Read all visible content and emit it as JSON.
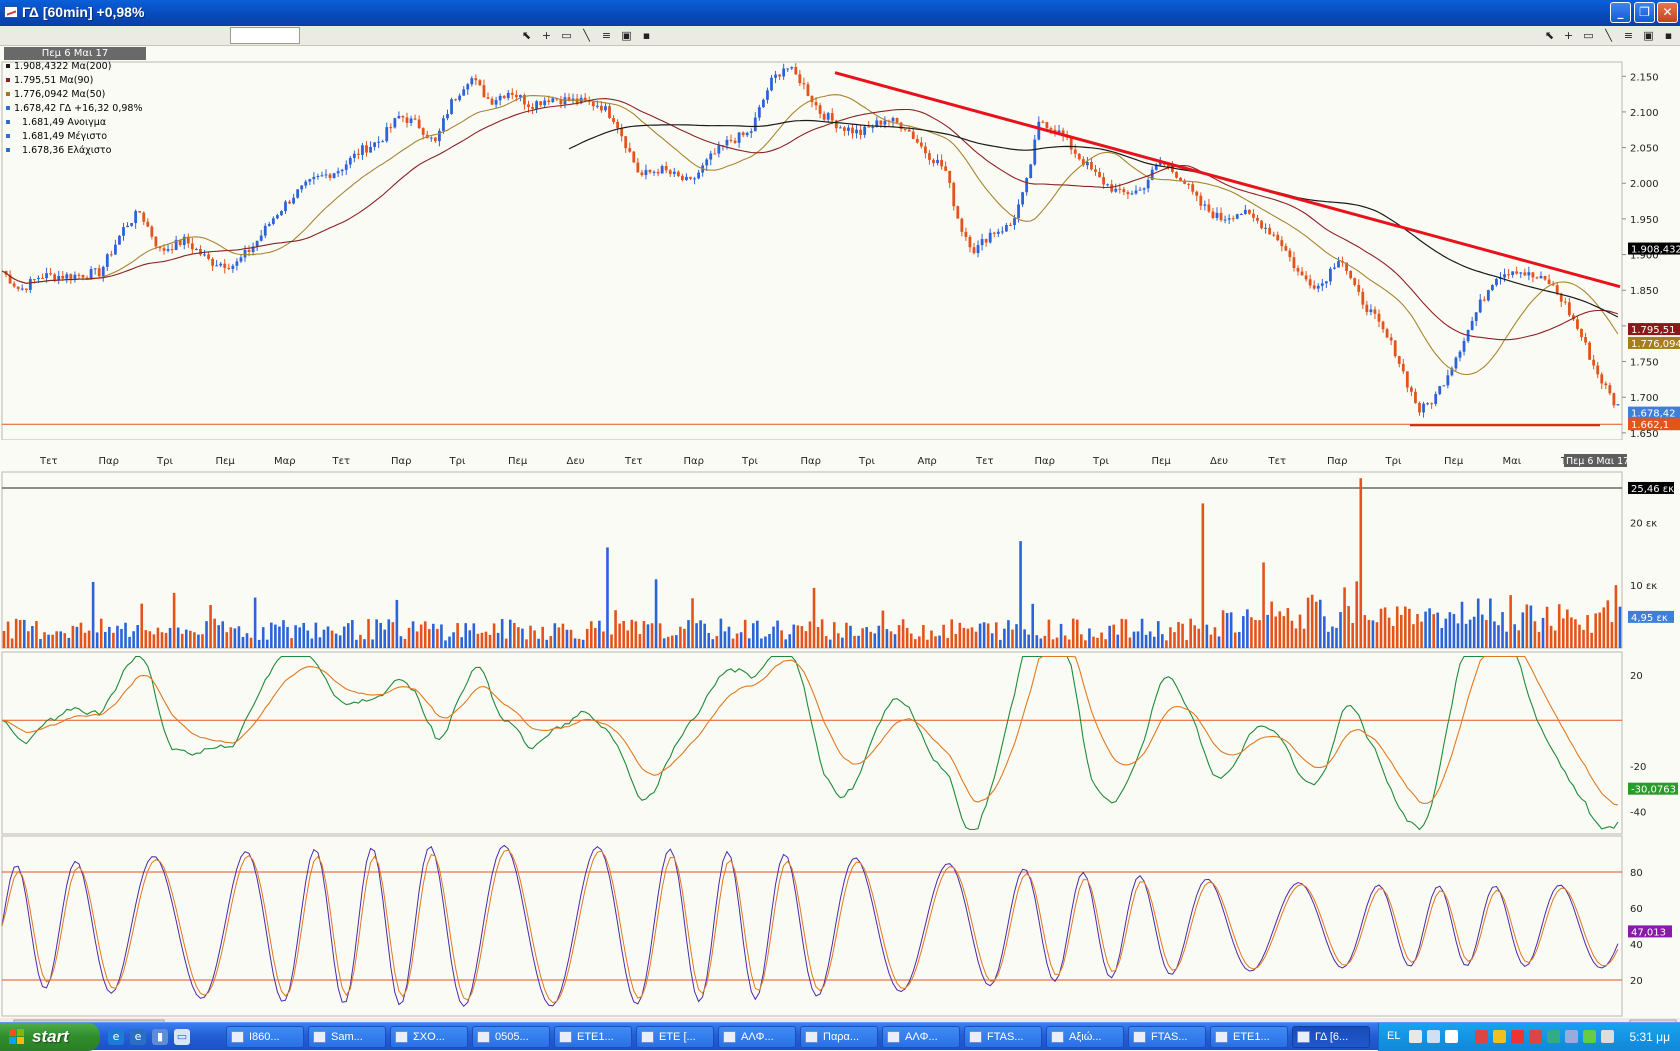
{
  "window": {
    "title": "ΓΔ [60min] +0,98%",
    "min": "_",
    "restore": "❐",
    "close": "✕"
  },
  "legend": {
    "date": "Πεμ 6 Μαι 17",
    "rows": [
      {
        "text": "1.908,4322 Μα(200)",
        "color": "#1a1a1a"
      },
      {
        "text": "1.795,51 Μα(90)",
        "color": "#8a2020"
      },
      {
        "text": "1.776,0942 Μα(50)",
        "color": "#9a7a2a"
      },
      {
        "text": "1.678,42 ΓΔ +16,32 0,98%",
        "color": "#2d6fc9"
      },
      {
        "text": "1.681,49 Ανοιγμα",
        "color": "#2d6fc9"
      },
      {
        "text": "1.681,49 Μέγιστο",
        "color": "#2d6fc9"
      },
      {
        "text": "1.678,36 Ελάχιστο",
        "color": "#2d6fc9"
      }
    ]
  },
  "price_axis": [
    "2.150",
    "2.100",
    "2.050",
    "2.000",
    "1.950",
    "1.900",
    "1.850",
    "1.800",
    "1.750",
    "1.700",
    "1.650"
  ],
  "price_tags": [
    {
      "text": "1.908,432",
      "value": 1908.43,
      "color": "#000000"
    },
    {
      "text": "1.795,51",
      "value": 1795.51,
      "color": "#8a1a1a"
    },
    {
      "text": "1.776,094",
      "value": 1776.09,
      "color": "#a67c1c"
    },
    {
      "text": "1.678,42",
      "value": 1678.42,
      "color": "#3d7fd9"
    },
    {
      "text": "1.662,1",
      "value": 1662.1,
      "color": "#e2541c"
    }
  ],
  "time_axis": [
    "Τετ",
    "Παρ",
    "Τρι",
    "Πεμ",
    "Μαρ",
    "Τετ",
    "Παρ",
    "Τρι",
    "Πεμ",
    "Δευ",
    "Τετ",
    "Παρ",
    "Τρι",
    "Παρ",
    "Τρι",
    "Απρ",
    "Τετ",
    "Παρ",
    "Τρι",
    "Πεμ",
    "Δευ",
    "Τετ",
    "Παρ",
    "Τρι",
    "Πεμ",
    "Μαι",
    "Τ"
  ],
  "time_cursor": "Πεμ 6 Μαι 17",
  "volume_axis": [
    "20 εκ",
    "10 εκ"
  ],
  "volume_tags": [
    {
      "text": "25,46 εκ",
      "color": "#000000"
    },
    {
      "text": "4,95 εκ",
      "color": "#3d7fd9"
    }
  ],
  "macd_axis": [
    "20",
    "-20",
    "-40"
  ],
  "macd_tags": [
    {
      "text": "-30,0763",
      "color": "#2a9a2a"
    }
  ],
  "stoch_axis": [
    "80",
    "60",
    "40",
    "20"
  ],
  "stoch_tags": [
    {
      "text": "47,013",
      "color": "#8a1aa8"
    }
  ],
  "colors": {
    "up": "#2d63d8",
    "down": "#e2541c",
    "trend": "#e8121a",
    "ma200": "#1a1a1a",
    "ma90": "#8a2222",
    "ma50": "#a8852f",
    "macd": "#1f8a3a",
    "signal": "#e07a20",
    "stochK": "#4a2aa8",
    "stochD": "#e07a20",
    "ref": "#e2541c"
  },
  "chart_data": {
    "type": "line",
    "title": "ΓΔ [60min]",
    "ylim": [
      1640,
      2170
    ],
    "close_points": [
      [
        0,
        1880
      ],
      [
        20,
        1850
      ],
      [
        40,
        1870
      ],
      [
        70,
        1870
      ],
      [
        100,
        1875
      ],
      [
        125,
        1940
      ],
      [
        140,
        1960
      ],
      [
        160,
        1905
      ],
      [
        185,
        1920
      ],
      [
        210,
        1890
      ],
      [
        235,
        1885
      ],
      [
        255,
        1915
      ],
      [
        275,
        1955
      ],
      [
        295,
        1985
      ],
      [
        315,
        2005
      ],
      [
        340,
        2020
      ],
      [
        360,
        2045
      ],
      [
        380,
        2060
      ],
      [
        400,
        2095
      ],
      [
        420,
        2080
      ],
      [
        435,
        2055
      ],
      [
        450,
        2110
      ],
      [
        470,
        2150
      ],
      [
        490,
        2115
      ],
      [
        510,
        2130
      ],
      [
        530,
        2110
      ],
      [
        550,
        2120
      ],
      [
        575,
        2115
      ],
      [
        600,
        2110
      ],
      [
        615,
        2090
      ],
      [
        640,
        2010
      ],
      [
        660,
        2020
      ],
      [
        690,
        2000
      ],
      [
        710,
        2035
      ],
      [
        730,
        2060
      ],
      [
        750,
        2070
      ],
      [
        770,
        2140
      ],
      [
        785,
        2165
      ],
      [
        800,
        2145
      ],
      [
        820,
        2100
      ],
      [
        840,
        2080
      ],
      [
        860,
        2070
      ],
      [
        885,
        2090
      ],
      [
        905,
        2080
      ],
      [
        925,
        2045
      ],
      [
        945,
        2020
      ],
      [
        960,
        1940
      ],
      [
        975,
        1905
      ],
      [
        990,
        1930
      ],
      [
        1010,
        1940
      ],
      [
        1025,
        1990
      ],
      [
        1040,
        2090
      ],
      [
        1060,
        2070
      ],
      [
        1080,
        2035
      ],
      [
        1100,
        2005
      ],
      [
        1120,
        1985
      ],
      [
        1140,
        1990
      ],
      [
        1160,
        2030
      ],
      [
        1180,
        2010
      ],
      [
        1200,
        1970
      ],
      [
        1220,
        1950
      ],
      [
        1240,
        1960
      ],
      [
        1260,
        1945
      ],
      [
        1280,
        1920
      ],
      [
        1300,
        1870
      ],
      [
        1320,
        1855
      ],
      [
        1340,
        1900
      ],
      [
        1355,
        1850
      ],
      [
        1375,
        1810
      ],
      [
        1395,
        1765
      ],
      [
        1410,
        1710
      ],
      [
        1420,
        1680
      ],
      [
        1435,
        1700
      ],
      [
        1450,
        1740
      ],
      [
        1465,
        1785
      ],
      [
        1480,
        1830
      ],
      [
        1495,
        1870
      ],
      [
        1515,
        1880
      ],
      [
        1530,
        1870
      ],
      [
        1550,
        1860
      ],
      [
        1565,
        1830
      ],
      [
        1580,
        1790
      ],
      [
        1595,
        1740
      ],
      [
        1615,
        1690
      ],
      [
        1635,
        1670
      ],
      [
        1655,
        1685
      ],
      [
        1680,
        1678
      ]
    ],
    "trendline_points": [
      [
        835,
        2155
      ],
      [
        1620,
        1855
      ]
    ],
    "support_level": 1662.1
  }
}
